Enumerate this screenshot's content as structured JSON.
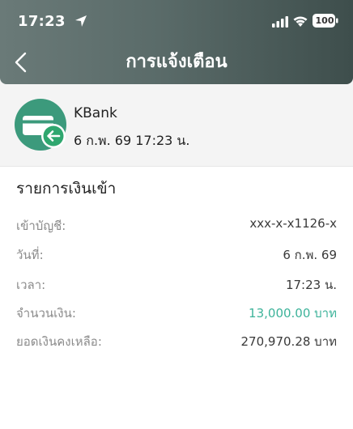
{
  "status_bar": {
    "time": "17:23",
    "battery": "100"
  },
  "header": {
    "title": "การแจ้งเตือน"
  },
  "sender": {
    "name": "KBank",
    "datetime": "6 ก.พ. 69 17:23 น."
  },
  "details": {
    "title": "รายการเงินเข้า",
    "rows": [
      {
        "label": "เข้าบัญชี:",
        "value": "xxx-x-x1126-x"
      },
      {
        "label": "วันที่:",
        "value": "6 ก.พ. 69"
      },
      {
        "label": "เวลา:",
        "value": "17:23 น."
      },
      {
        "label": "จำนวนเงิน:",
        "value": "13,000.00 บาท"
      },
      {
        "label": "ยอดเงินคงเหลือ:",
        "value": "270,970.28 บาท"
      }
    ]
  },
  "colors": {
    "accent_green": "#3db39a",
    "header_dark": "#3e4e4c"
  }
}
